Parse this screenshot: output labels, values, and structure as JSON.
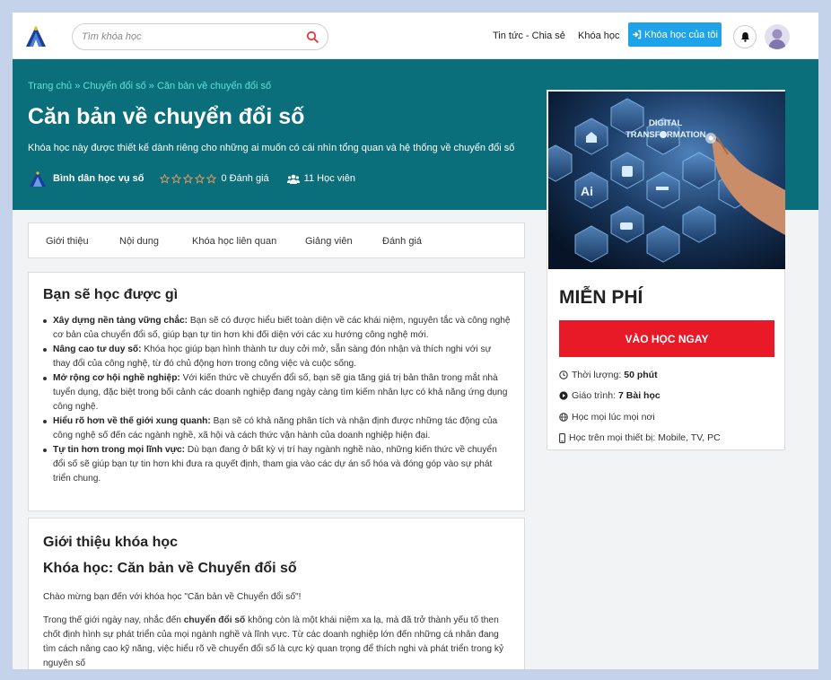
{
  "header": {
    "search_placeholder": "Tìm khóa học",
    "nav_news": "Tin tức - Chia sẻ",
    "nav_courses": "Khóa học",
    "my_courses_label": "Khóa học của tôi"
  },
  "hero": {
    "breadcrumb": [
      "Trang chủ",
      "Chuyển đổi số",
      "Căn bản về chuyển đổi số"
    ],
    "breadcrumb_sep": "»",
    "title": "Căn bản về chuyển đổi số",
    "description": "Khóa học này được thiết kế dành riêng cho những ai muốn có cái nhìn tổng quan và hệ thống về chuyển đổi số",
    "org_name": "Bình dân học vụ số",
    "rating_text": "0 Đánh giá",
    "students_text": "11 Học viên",
    "rating_value": 0,
    "rating_max": 5
  },
  "tabs": [
    "Giới thiệu",
    "Nội dung",
    "Khóa học liên quan",
    "Giảng viên",
    "Đánh giá"
  ],
  "learn": {
    "title": "Bạn sẽ học được gì",
    "items": [
      {
        "bold": "Xây dựng nền tảng vững chắc:",
        "text": " Bạn sẽ có được hiểu biết toàn diện về các khái niệm, nguyên tắc và công nghệ cơ bản của chuyển đổi số, giúp bạn tự tin hơn khi đối diện với các xu hướng công nghệ mới."
      },
      {
        "bold": "Nâng cao tư duy số:",
        "text": " Khóa học giúp bạn hình thành tư duy cởi mở, sẵn sàng đón nhận và thích nghi với sự thay đổi của công nghệ, từ đó chủ động hơn trong công việc và cuộc sống."
      },
      {
        "bold": "Mở rộng cơ hội nghề nghiệp:",
        "text": " Với kiến thức về chuyển đổi số, bạn sẽ gia tăng giá trị bản thân trong mắt nhà tuyển dụng, đặc biệt trong bối cảnh các doanh nghiệp đang ngày càng tìm kiếm nhân lực có khả năng ứng dụng công nghệ."
      },
      {
        "bold": "Hiểu rõ hơn về thế giới xung quanh:",
        "text": " Bạn sẽ có khả năng phân tích và nhận định được những tác động của công nghệ số đến các ngành nghề, xã hội và cách thức vận hành của doanh nghiệp hiện đại."
      },
      {
        "bold": "Tự tin hơn trong mọi lĩnh vực:",
        "text": " Dù bạn đang ở bất kỳ vị trí hay ngành nghề nào, những kiến thức về chuyển đổi số sẽ giúp bạn tự tin hơn khi đưa ra quyết định, tham gia vào các dự án số hóa và đóng góp vào sự phát triển chung."
      }
    ]
  },
  "intro": {
    "title": "Giới thiệu khóa học",
    "subtitle": "Khóa học: Căn bản về Chuyển đổi số",
    "p1": "Chào mừng bạn đến với khóa học \"Căn bản về Chuyển đổi số\"!",
    "p2_before": "Trong thế giới ngày nay, nhắc đến ",
    "p2_bold": "chuyển đổi số",
    "p2_after": " không còn là một khái niệm xa lạ, mà đã trở thành yếu tố then chốt định hình sự phát triển của mọi ngành nghề và lĩnh vực. Từ các doanh nghiệp lớn đến những cá nhân đang tìm cách nâng cao kỹ năng, việc hiểu rõ về chuyển đổi số là cực kỳ quan trọng để thích nghi và phát triển trong kỷ nguyên số"
  },
  "sidebar": {
    "thumb_text_1": "DIGITAL",
    "thumb_text_2": "TRANSFORMATION",
    "thumb_ai": "Ai",
    "price": "MIỄN PHÍ",
    "enroll_label": "VÀO HỌC NGAY",
    "duration_label": "Thời lượng:",
    "duration_value": "50 phút",
    "lessons_label": "Giáo trình:",
    "lessons_value": "7 Bài học",
    "anywhere": "Học mọi lúc mọi nơi",
    "devices": "Học trên mọi thiết bị: Mobile, TV, PC"
  },
  "colors": {
    "hero_bg": "#0b6e7b",
    "breadcrumb": "#5fe3d8",
    "primary_btn": "#1ea2ea",
    "enroll_btn": "#e81a28"
  }
}
